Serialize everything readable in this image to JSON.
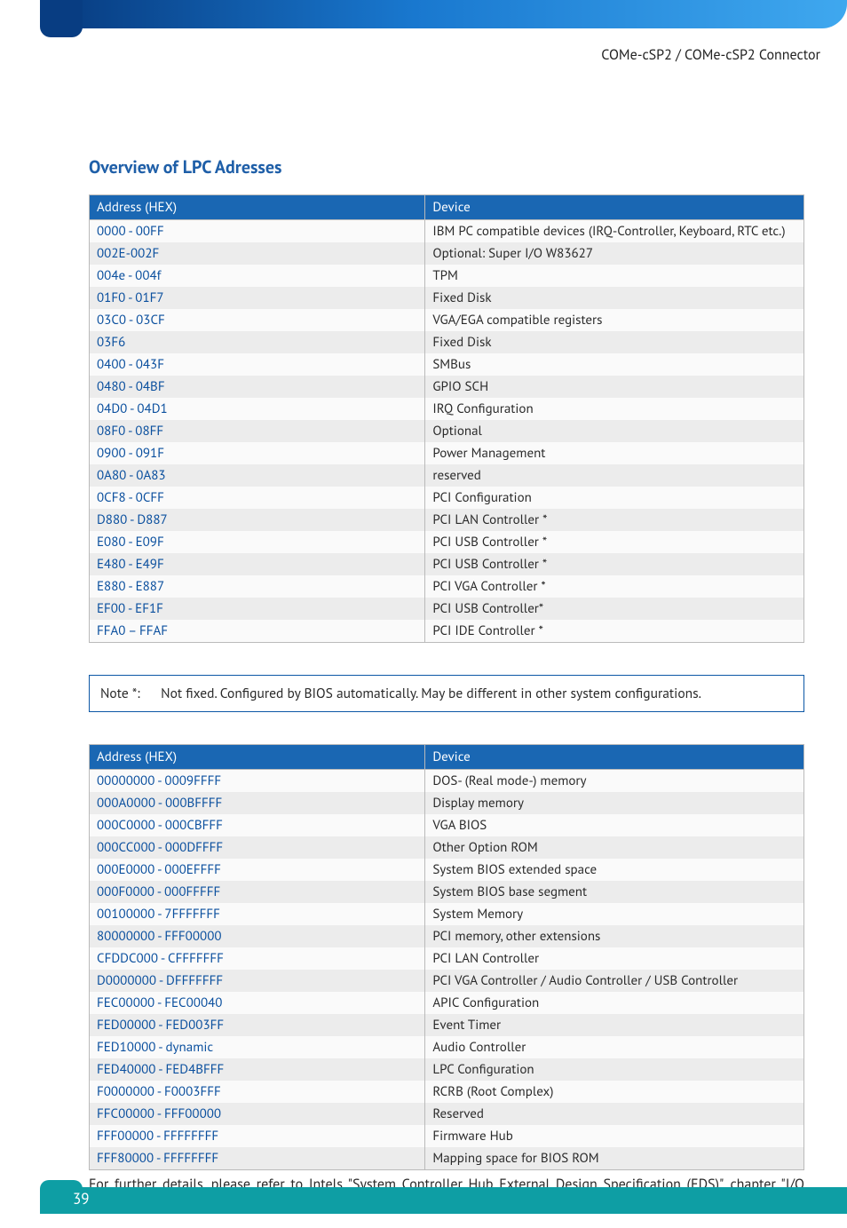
{
  "header": {
    "breadcrumb": "COMe-cSP2 / COMe-cSP2 Connector"
  },
  "section_title": "Overview of LPC Adresses",
  "table1": {
    "head_addr": "Address (HEX)",
    "head_dev": "Device",
    "rows": [
      {
        "addr": "0000 - 00FF",
        "dev": "IBM PC compatible devices (IRQ-Controller, Keyboard, RTC etc.)"
      },
      {
        "addr": "002E-002F",
        "dev": "Optional: Super I/O W83627"
      },
      {
        "addr": "004e - 004f",
        "dev": "TPM"
      },
      {
        "addr": "01F0 - 01F7",
        "dev": "Fixed Disk"
      },
      {
        "addr": "03C0 - 03CF",
        "dev": "VGA/EGA compatible registers"
      },
      {
        "addr": "03F6",
        "dev": "Fixed Disk"
      },
      {
        "addr": "0400 - 043F",
        "dev": "SMBus"
      },
      {
        "addr": "0480 - 04BF",
        "dev": "GPIO SCH"
      },
      {
        "addr": "04D0 - 04D1",
        "dev": "IRQ Configuration"
      },
      {
        "addr": "08F0 - 08FF",
        "dev": "Optional"
      },
      {
        "addr": "0900 - 091F",
        "dev": "Power Management"
      },
      {
        "addr": "0A80 - 0A83",
        "dev": "reserved"
      },
      {
        "addr": "0CF8 - 0CFF",
        "dev": "PCI Configuration"
      },
      {
        "addr": "D880 - D887",
        "dev": "PCI LAN Controller *"
      },
      {
        "addr": "E080 - E09F",
        "dev": "PCI USB Controller *"
      },
      {
        "addr": "E480 - E49F",
        "dev": "PCI USB Controller *"
      },
      {
        "addr": "E880 - E887",
        "dev": "PCI VGA Controller *"
      },
      {
        "addr": "EF00 - EF1F",
        "dev": "PCI USB Controller*"
      },
      {
        "addr": "FFA0 – FFAF",
        "dev": "PCI IDE Controller *"
      }
    ]
  },
  "note": {
    "label": "Note *:",
    "text": "Not fixed. Configured by BIOS automatically. May be different in other system configurations."
  },
  "table2": {
    "head_addr": "Address (HEX)",
    "head_dev": "Device",
    "rows": [
      {
        "addr": "00000000 - 0009FFFF",
        "dev": "DOS- (Real mode-) memory"
      },
      {
        "addr": "000A0000 - 000BFFFF",
        "dev": "Display memory"
      },
      {
        "addr": "000C0000 - 000CBFFF",
        "dev": "VGA BIOS"
      },
      {
        "addr": "000CC000 - 000DFFFF",
        "dev": "Other Option ROM"
      },
      {
        "addr": "000E0000 - 000EFFFF",
        "dev": "System BIOS extended space"
      },
      {
        "addr": "000F0000 - 000FFFFF",
        "dev": "System BIOS base segment"
      },
      {
        "addr": "00100000 - 7FFFFFFF",
        "dev": "System Memory"
      },
      {
        "addr": "80000000 - FFF00000",
        "dev": "PCI memory, other extensions"
      },
      {
        "addr": "CFDDC000 - CFFFFFFF",
        "dev": "PCI LAN Controller"
      },
      {
        "addr": "D0000000 - DFFFFFFF",
        "dev": "PCI VGA Controller / Audio Controller / USB Controller"
      },
      {
        "addr": "FEC00000 - FEC00040",
        "dev": "APIC Configuration"
      },
      {
        "addr": "FED00000 - FED003FF",
        "dev": "Event Timer"
      },
      {
        "addr": "FED10000 - dynamic",
        "dev": "Audio Controller"
      },
      {
        "addr": "FED40000 - FED4BFFF",
        "dev": "LPC Configuration"
      },
      {
        "addr": "F0000000 - F0003FFF",
        "dev": "RCRB (Root Complex)"
      },
      {
        "addr": "FFC00000 - FFF00000",
        "dev": "Reserved"
      },
      {
        "addr": "FFF00000 - FFFFFFFF",
        "dev": "Firmware Hub"
      },
      {
        "addr": "FFF80000 - FFFFFFFF",
        "dev": "Mapping space for BIOS ROM"
      }
    ]
  },
  "refer_text": "For further details, please refer to Intels \"System Controller Hub External Design Specification (EDS)\", chapter \"I/O Address Space\".",
  "page_number": "39"
}
